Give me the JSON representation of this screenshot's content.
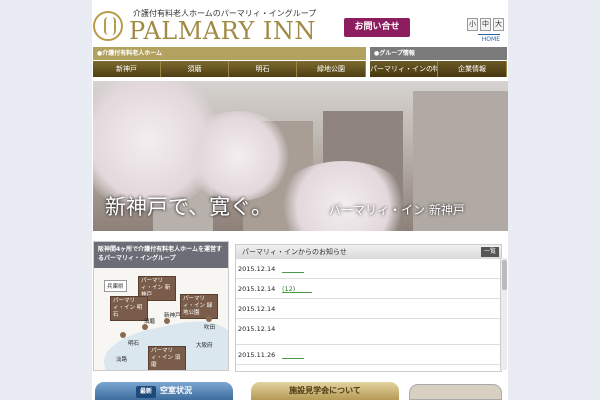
{
  "header": {
    "tagline": "介護付有料老人ホームのパーマリィ・イングループ",
    "logo_text": "PALMARY INN",
    "contact_label": "お問い合せ",
    "font_sizes": [
      "小",
      "中",
      "大"
    ],
    "home_label": "HOME"
  },
  "nav_left": {
    "heading": "●介護付有料老人ホーム",
    "items": [
      "新神戸",
      "須磨",
      "明石",
      "緑地公園"
    ]
  },
  "nav_right": {
    "heading": "●グループ情報",
    "items": [
      "パーマリィ・インの特徴",
      "企業情報"
    ]
  },
  "hero": {
    "main_text": "新神戸で、寛ぐ。",
    "sub_text": "パーマリィ・イン 新神戸"
  },
  "map_panel": {
    "title": "阪神間4ヶ所で介護付有料老人ホームを運営するパーマリィ・イングループ",
    "labels": {
      "hyogo": "兵庫県",
      "shinkobe_facility": "パーマリィ・イン 新神戸",
      "akashi_facility": "パーマリィ・イン 明石",
      "ryokuchi_facility": "パーマリィ・イン 緑地公園",
      "suma_facility": "パーマリィ・イン 須磨",
      "suma": "須磨",
      "shinkobe": "新神戸",
      "suita": "吹田",
      "akashi": "明石",
      "osaka": "大阪府",
      "awaji": "淡路"
    }
  },
  "news": {
    "title": "パーマリィ・インからのお知らせ",
    "list_label": "一覧",
    "items": [
      {
        "date": "2015.12.14",
        "text": ""
      },
      {
        "date": "2015.12.14",
        "text": "(12)"
      },
      {
        "date": "2015.12.14",
        "text": ""
      },
      {
        "date": "2015.12.14",
        "text": ""
      },
      {
        "date": "2015.11.26",
        "text": ""
      }
    ]
  },
  "banners": {
    "recruit_tag": "最新",
    "recruit_label": "空室状況",
    "tour_label": "施設見学会について"
  },
  "colors": {
    "brand_gold": "#a08a44",
    "contact_purple": "#8c1d5e",
    "nav_brown": "#5a4a18"
  }
}
